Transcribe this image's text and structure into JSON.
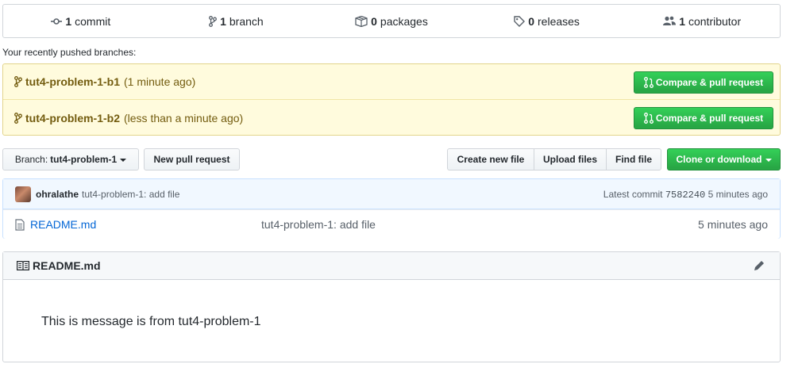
{
  "summary": {
    "commits": {
      "count": "1",
      "label": "commit",
      "icon": "commit-icon"
    },
    "branches": {
      "count": "1",
      "label": "branch",
      "icon": "branch-icon"
    },
    "packages": {
      "count": "0",
      "label": "packages",
      "icon": "package-icon"
    },
    "releases": {
      "count": "0",
      "label": "releases",
      "icon": "tag-icon"
    },
    "contributors": {
      "count": "1",
      "label": "contributor",
      "icon": "people-icon"
    }
  },
  "recent": {
    "label": "Your recently pushed branches:",
    "branches": [
      {
        "name": "tut4-problem-1-b1",
        "ago": "(1 minute ago)",
        "button": "Compare & pull request"
      },
      {
        "name": "tut4-problem-1-b2",
        "ago": "(less than a minute ago)",
        "button": "Compare & pull request"
      }
    ]
  },
  "nav": {
    "branch_prefix": "Branch:",
    "branch_value": "tut4-problem-1",
    "new_pr": "New pull request",
    "create_file": "Create new file",
    "upload_files": "Upload files",
    "find_file": "Find file",
    "clone": "Clone or download"
  },
  "commit": {
    "author": "ohralathe",
    "message": "tut4-problem-1: add file",
    "latest_label": "Latest commit",
    "sha": "7582240",
    "age": "5 minutes ago"
  },
  "files": [
    {
      "name": "README.md",
      "message": "tut4-problem-1: add file",
      "age": "5 minutes ago"
    }
  ],
  "readme": {
    "title": "README.md",
    "body": "This is message is from tut4-problem-1"
  },
  "colors": {
    "accent_green": "#28a745",
    "link_blue": "#0366d6",
    "notice_yellow": "#fffbdd"
  }
}
